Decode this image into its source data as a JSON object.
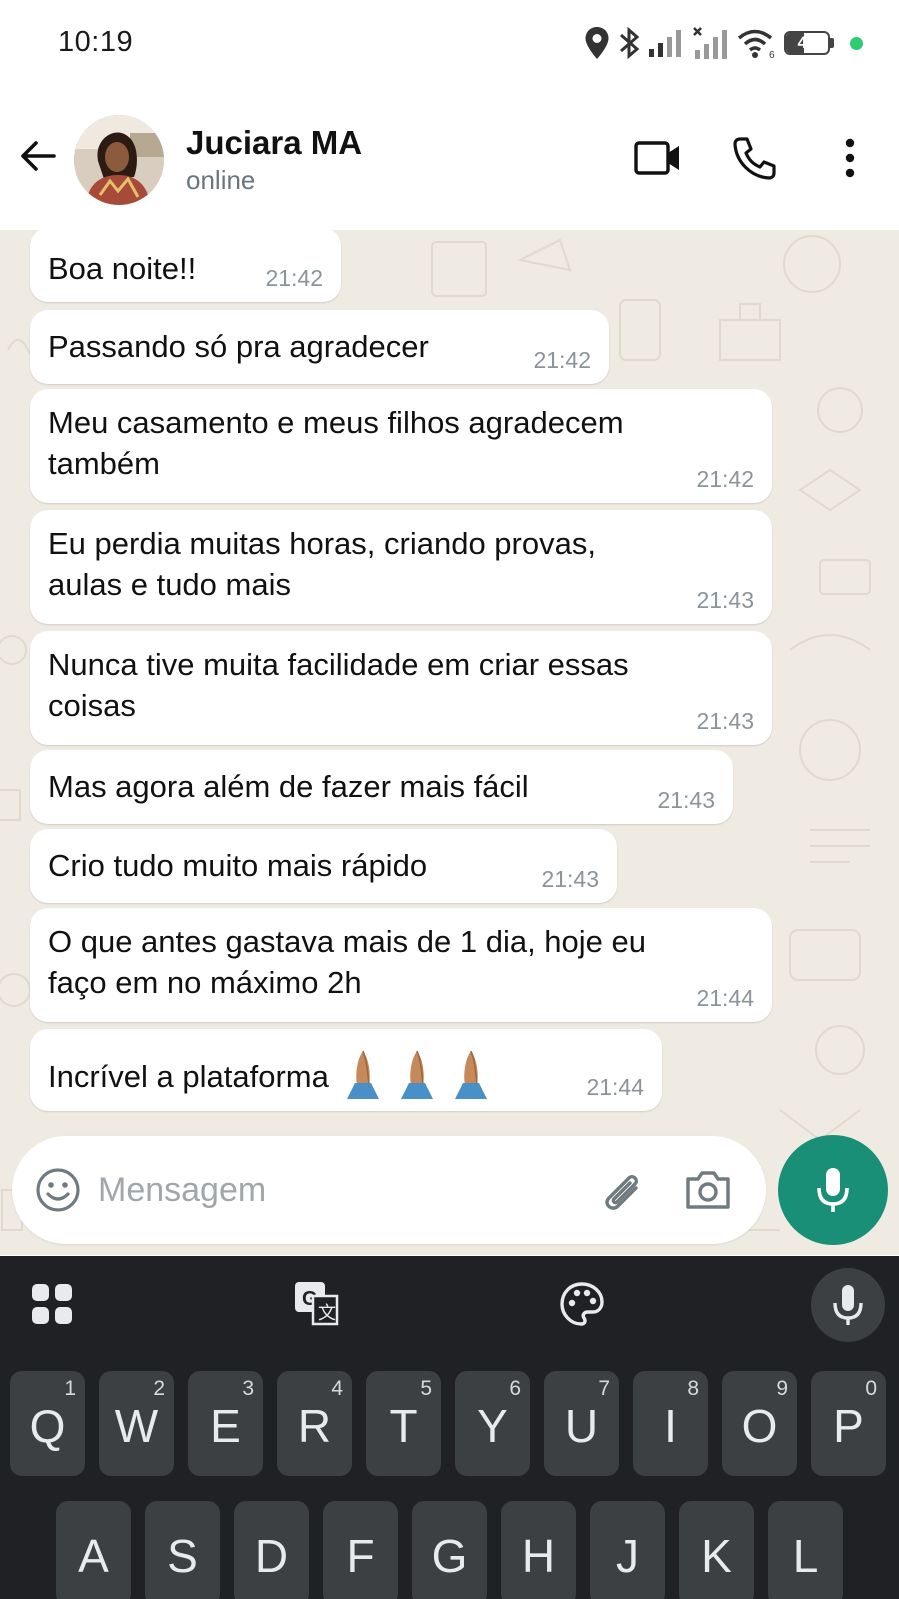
{
  "status_bar": {
    "time": "10:19",
    "battery_level": "42",
    "icons": [
      "location-icon",
      "bluetooth-icon",
      "signal-icon",
      "no-signal-icon",
      "wifi-icon",
      "battery-icon",
      "green-dot-indicator"
    ]
  },
  "header": {
    "contact_name": "Juciara MA",
    "contact_status": "online",
    "actions": [
      "back-arrow-icon",
      "video-call-icon",
      "phone-icon",
      "more-vertical-icon"
    ]
  },
  "messages": [
    {
      "text": "Boa noite!!",
      "time": "21:42"
    },
    {
      "text": "Passando só pra agradecer",
      "time": "21:42"
    },
    {
      "text": "Meu casamento e meus filhos agradecem também",
      "line1": "Meu casamento e meus filhos agradecem",
      "line2": "também",
      "time": "21:42"
    },
    {
      "text": "Eu perdia muitas horas, criando provas, aulas e tudo mais",
      "line1": "Eu perdia muitas horas, criando provas,",
      "line2": "aulas e tudo mais",
      "time": "21:43"
    },
    {
      "text": "Nunca tive muita facilidade em criar essas coisas",
      "line1": "Nunca tive muita facilidade em criar essas",
      "line2": "coisas",
      "time": "21:43"
    },
    {
      "text": "Mas agora além de fazer mais fácil",
      "time": "21:43"
    },
    {
      "text": "Crio tudo muito mais rápido",
      "time": "21:43"
    },
    {
      "text": "O que antes gastava mais de 1 dia, hoje eu faço em no máximo 2h",
      "line1": "O que antes gastava mais de 1 dia, hoje eu",
      "line2": "faço em no máximo 2h",
      "time": "21:44"
    },
    {
      "text": "Incrível a plataforma",
      "emoji": "🙏🙏🙏",
      "time": "21:44"
    }
  ],
  "composer": {
    "placeholder": "Mensagem",
    "icons": [
      "emoji-icon",
      "paperclip-icon",
      "camera-icon",
      "microphone-icon"
    ]
  },
  "keyboard": {
    "toolbar": [
      "apps-grid-icon",
      "translate-icon",
      "palette-icon",
      "microphone-icon"
    ],
    "row1": [
      {
        "letter": "Q",
        "hint": "1"
      },
      {
        "letter": "W",
        "hint": "2"
      },
      {
        "letter": "E",
        "hint": "3"
      },
      {
        "letter": "R",
        "hint": "4"
      },
      {
        "letter": "T",
        "hint": "5"
      },
      {
        "letter": "Y",
        "hint": "6"
      },
      {
        "letter": "U",
        "hint": "7"
      },
      {
        "letter": "I",
        "hint": "8"
      },
      {
        "letter": "O",
        "hint": "9"
      },
      {
        "letter": "P",
        "hint": "0"
      }
    ],
    "row2": [
      {
        "letter": "A"
      },
      {
        "letter": "S"
      },
      {
        "letter": "D"
      },
      {
        "letter": "F"
      },
      {
        "letter": "G"
      },
      {
        "letter": "H"
      },
      {
        "letter": "J"
      },
      {
        "letter": "K"
      },
      {
        "letter": "L"
      }
    ]
  },
  "colors": {
    "chat_background": "#efeae2",
    "bubble": "#ffffff",
    "accent": "#1a8f77",
    "keyboard": "#202124",
    "key": "#3c4043"
  }
}
